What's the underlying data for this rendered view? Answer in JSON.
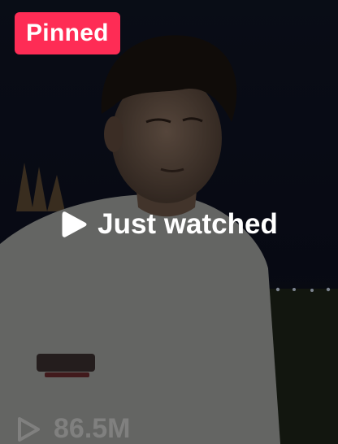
{
  "video_tile": {
    "pinned_label": "Pinned",
    "overlay_label": "Just watched",
    "view_count": "86.5M",
    "icons": {
      "overlay": "play-icon",
      "views": "play-outline-icon"
    },
    "colors": {
      "pinned_badge": "#fe2c55",
      "overlay_text": "#ffffff",
      "view_count_text": "#ffffff"
    }
  }
}
